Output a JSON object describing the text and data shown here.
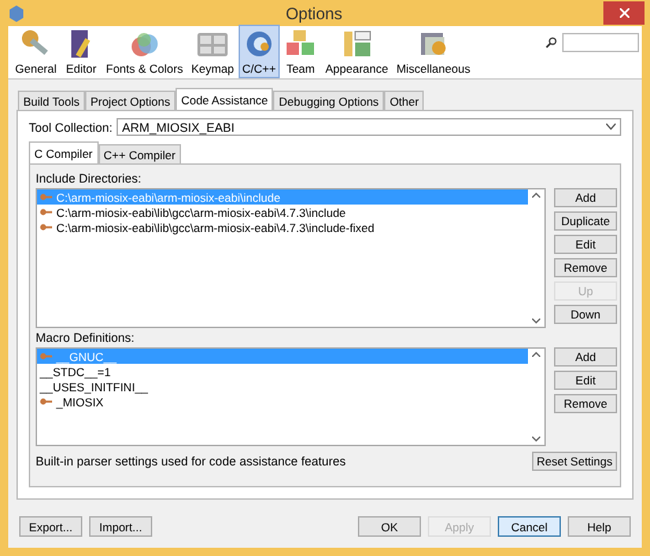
{
  "window": {
    "title": "Options"
  },
  "categories": [
    {
      "label": "General",
      "selected": false
    },
    {
      "label": "Editor",
      "selected": false
    },
    {
      "label": "Fonts & Colors",
      "selected": false
    },
    {
      "label": "Keymap",
      "selected": false
    },
    {
      "label": "C/C++",
      "selected": true
    },
    {
      "label": "Team",
      "selected": false
    },
    {
      "label": "Appearance",
      "selected": false
    },
    {
      "label": "Miscellaneous",
      "selected": false
    }
  ],
  "tabs": [
    {
      "label": "Build Tools",
      "selected": false
    },
    {
      "label": "Project Options",
      "selected": false
    },
    {
      "label": "Code Assistance",
      "selected": true
    },
    {
      "label": "Debugging Options",
      "selected": false
    },
    {
      "label": "Other",
      "selected": false
    }
  ],
  "tool_collection": {
    "label": "Tool Collection:",
    "value": "ARM_MIOSIX_EABI"
  },
  "compiler_tabs": [
    {
      "label": "C Compiler",
      "selected": true
    },
    {
      "label": "C++ Compiler",
      "selected": false
    }
  ],
  "include": {
    "label": "Include Directories:",
    "items": [
      {
        "text": "C:\\arm-miosix-eabi\\arm-miosix-eabi\\include",
        "kind": "builtin",
        "selected": true
      },
      {
        "text": "C:\\arm-miosix-eabi\\lib\\gcc\\arm-miosix-eabi\\4.7.3\\include",
        "kind": "builtin",
        "selected": false
      },
      {
        "text": "C:\\arm-miosix-eabi\\lib\\gcc\\arm-miosix-eabi\\4.7.3\\include-fixed",
        "kind": "builtin",
        "selected": false
      }
    ],
    "buttons": [
      {
        "label": "Add",
        "disabled": false
      },
      {
        "label": "Duplicate",
        "disabled": false
      },
      {
        "label": "Edit",
        "disabled": false
      },
      {
        "label": "Remove",
        "disabled": false
      },
      {
        "label": "Up",
        "disabled": true
      },
      {
        "label": "Down",
        "disabled": false
      }
    ]
  },
  "macros": {
    "label": "Macro Definitions:",
    "items": [
      {
        "text": "__GNUC__",
        "kind": "builtin",
        "selected": true
      },
      {
        "text": "__STDC__=1",
        "kind": "user",
        "selected": false
      },
      {
        "text": "__USES_INITFINI__",
        "kind": "user",
        "selected": false
      },
      {
        "text": "_MIOSIX",
        "kind": "builtin",
        "selected": false
      }
    ],
    "buttons": [
      {
        "label": "Add",
        "disabled": false
      },
      {
        "label": "Edit",
        "disabled": false
      },
      {
        "label": "Remove",
        "disabled": false
      }
    ]
  },
  "note": "Built-in parser settings used for code assistance features",
  "reset_button": "Reset Settings",
  "left_buttons": [
    {
      "label": "Export...",
      "disabled": false
    },
    {
      "label": "Import...",
      "disabled": false
    }
  ],
  "right_buttons": [
    {
      "label": "OK",
      "disabled": false,
      "default": false
    },
    {
      "label": "Apply",
      "disabled": true,
      "default": false
    },
    {
      "label": "Cancel",
      "disabled": false,
      "default": true
    },
    {
      "label": "Help",
      "disabled": false,
      "default": false
    }
  ]
}
